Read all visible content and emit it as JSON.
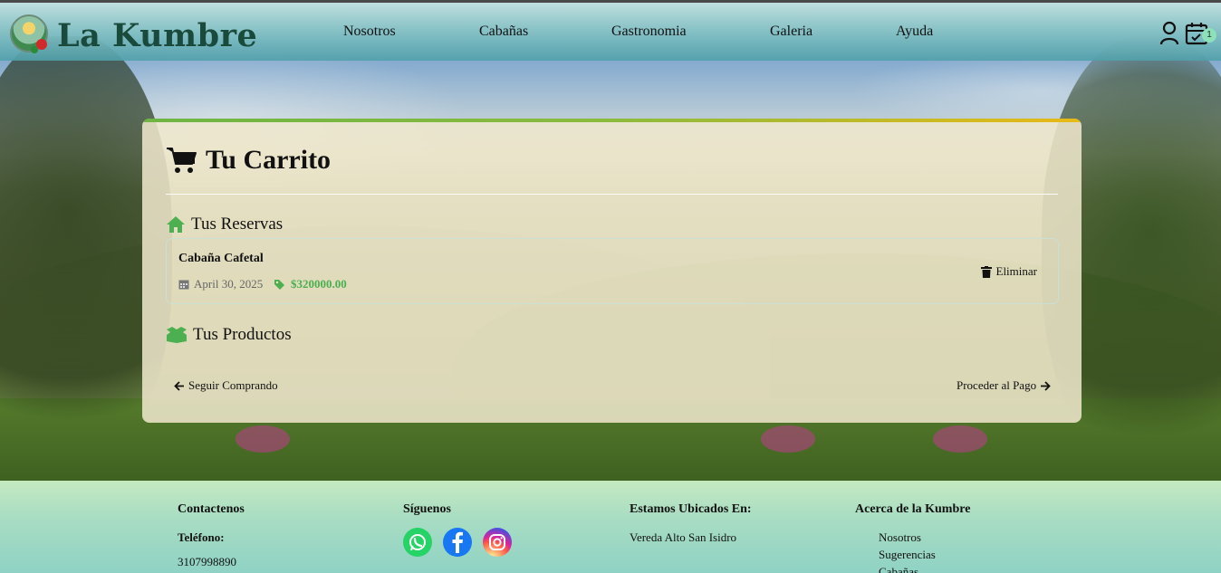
{
  "header": {
    "brand": "La Kumbre",
    "nav": [
      "Nosotros",
      "Cabañas",
      "Gastronomia",
      "Galeria",
      "Ayuda"
    ],
    "cart_count": "1"
  },
  "cart": {
    "title": "Tu Carrito",
    "reservations_heading": "Tus Reservas",
    "reservation": {
      "name": "Cabaña Cafetal",
      "date": "April 30, 2025",
      "price": "$320000.00",
      "delete_label": "Eliminar"
    },
    "products_heading": "Tus Productos",
    "continue_label": "Seguir Comprando",
    "checkout_label": "Proceder al Pago"
  },
  "footer": {
    "contact_heading": "Contactenos",
    "phone_label": "Teléfono:",
    "phone_value": "3107998890",
    "follow_heading": "Síguenos",
    "location_heading": "Estamos Ubicados En:",
    "location_value": "Vereda Alto San Isidro",
    "about_heading": "Acerca de la Kumbre",
    "about_links": [
      "Nosotros",
      "Sugerencias",
      "Cabañas"
    ]
  },
  "colors": {
    "accent_green": "#4caf50",
    "brand_text": "#1a4a3c",
    "card_bg": "#f0e8cd",
    "footer_gradient_top": "#c4e9c0"
  }
}
